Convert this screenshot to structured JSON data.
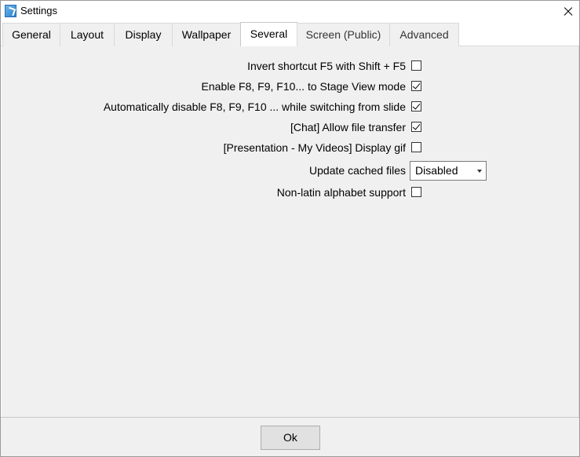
{
  "window": {
    "title": "Settings"
  },
  "tabs": [
    {
      "label": "General"
    },
    {
      "label": "Layout"
    },
    {
      "label": "Display"
    },
    {
      "label": "Wallpaper"
    },
    {
      "label": "Several",
      "active": true
    },
    {
      "label": "Screen (Public)"
    },
    {
      "label": "Advanced"
    }
  ],
  "options": {
    "invert_f5": {
      "label": "Invert shortcut F5 with Shift + F5",
      "checked": false
    },
    "enable_f8": {
      "label": "Enable F8, F9, F10... to Stage View mode",
      "checked": true
    },
    "auto_disable_f8": {
      "label": "Automatically disable F8, F9, F10 ... while switching from slide",
      "checked": true
    },
    "chat_file_transfer": {
      "label": "[Chat] Allow file transfer",
      "checked": true
    },
    "display_gif": {
      "label": "[Presentation - My Videos] Display gif",
      "checked": false
    },
    "update_cached": {
      "label": "Update cached files",
      "value": "Disabled"
    },
    "non_latin": {
      "label": "Non-latin alphabet support",
      "checked": false
    }
  },
  "footer": {
    "ok_label": "Ok"
  },
  "colors": {
    "window_bg": "#f0f0f0",
    "tab_active_bg": "#ffffff",
    "border": "#d9d9d9"
  }
}
